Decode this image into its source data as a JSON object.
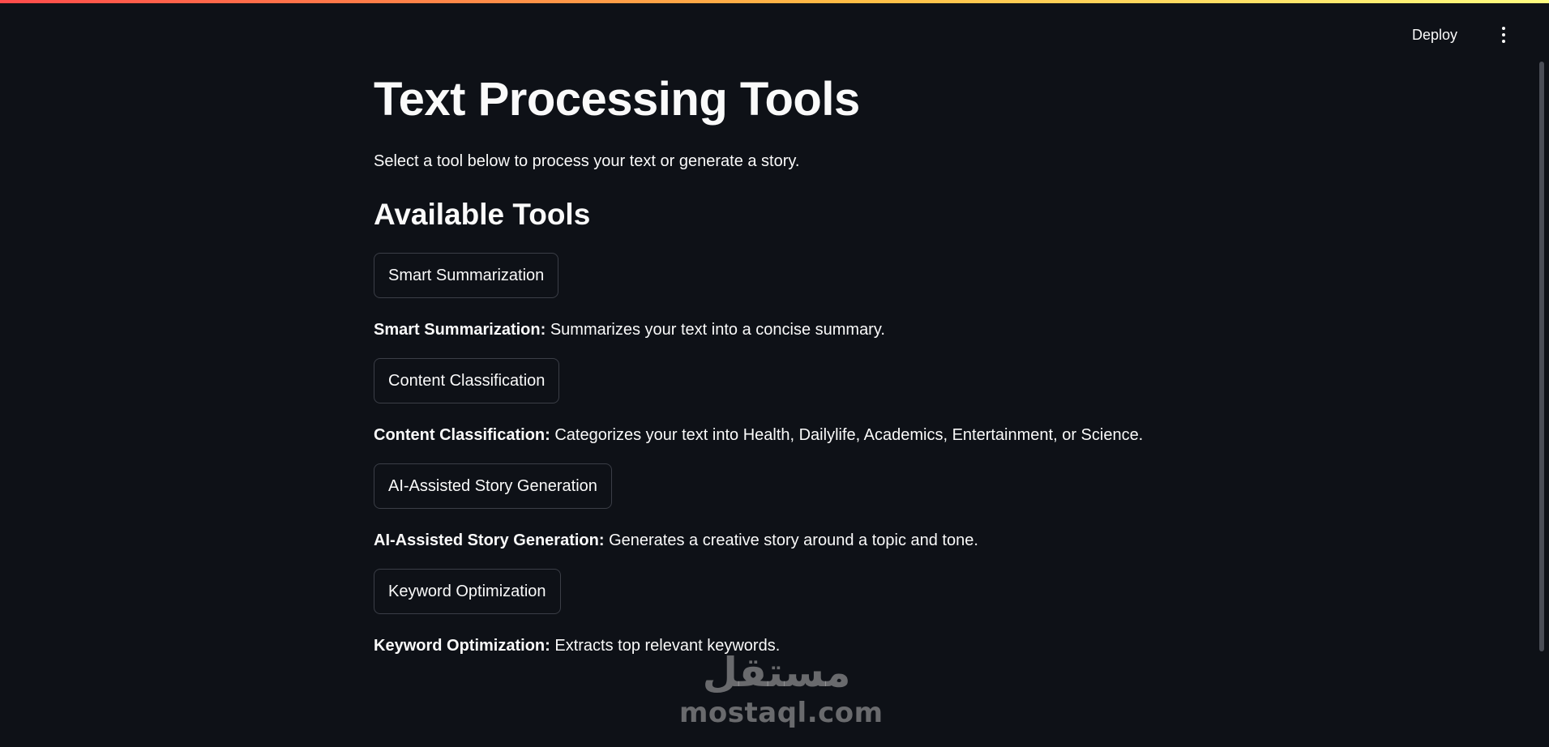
{
  "header": {
    "deploy_label": "Deploy",
    "menu_icon": "vertical-ellipsis-icon"
  },
  "page": {
    "title": "Text Processing Tools",
    "intro": "Select a tool below to process your text or generate a story.",
    "section_heading": "Available Tools"
  },
  "tools": [
    {
      "button_label": "Smart Summarization",
      "desc_name": "Smart Summarization:",
      "desc_text": " Summarizes your text into a concise summary."
    },
    {
      "button_label": "Content Classification",
      "desc_name": "Content Classification:",
      "desc_text": " Categorizes your text into Health, Dailylife, Academics, Entertainment, or Science."
    },
    {
      "button_label": "AI-Assisted Story Generation",
      "desc_name": "AI-Assisted Story Generation:",
      "desc_text": " Generates a creative story around a topic and tone."
    },
    {
      "button_label": "Keyword Optimization",
      "desc_name": "Keyword Optimization:",
      "desc_text": " Extracts top relevant keywords."
    }
  ],
  "watermark": {
    "arabic": "مستقل",
    "latin": "mostaql.com"
  },
  "colors": {
    "background": "#0e1117",
    "text": "#fafafa",
    "button_border": "#3b3e47",
    "gradient_start": "#ff4b4b",
    "gradient_end": "#fffd80"
  }
}
